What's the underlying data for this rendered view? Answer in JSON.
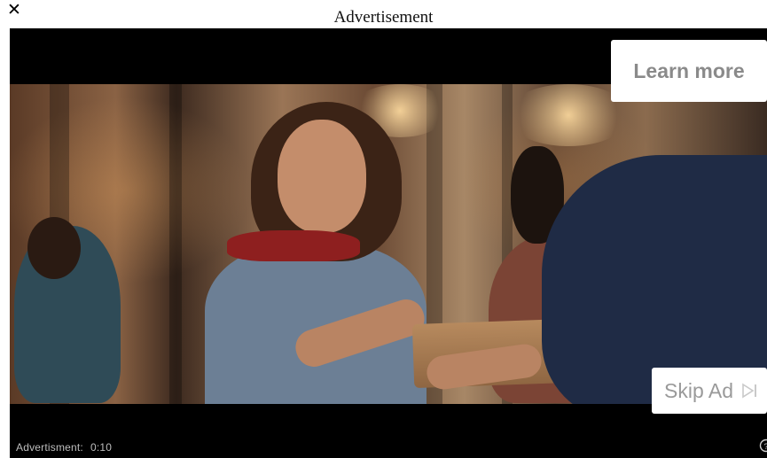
{
  "dialog": {
    "close_glyph": "✕",
    "heading": "Advertisement"
  },
  "video": {
    "learn_more_label": "Learn more",
    "skip_label": "Skip Ad",
    "skip_icon": "skip-next-icon",
    "status_label": "Advertisment:",
    "time_remaining": "0:10",
    "info_icon": "info-icon"
  },
  "colors": {
    "player_background": "#000000",
    "button_background": "#ffffff",
    "button_text": "#8a8a8a"
  }
}
